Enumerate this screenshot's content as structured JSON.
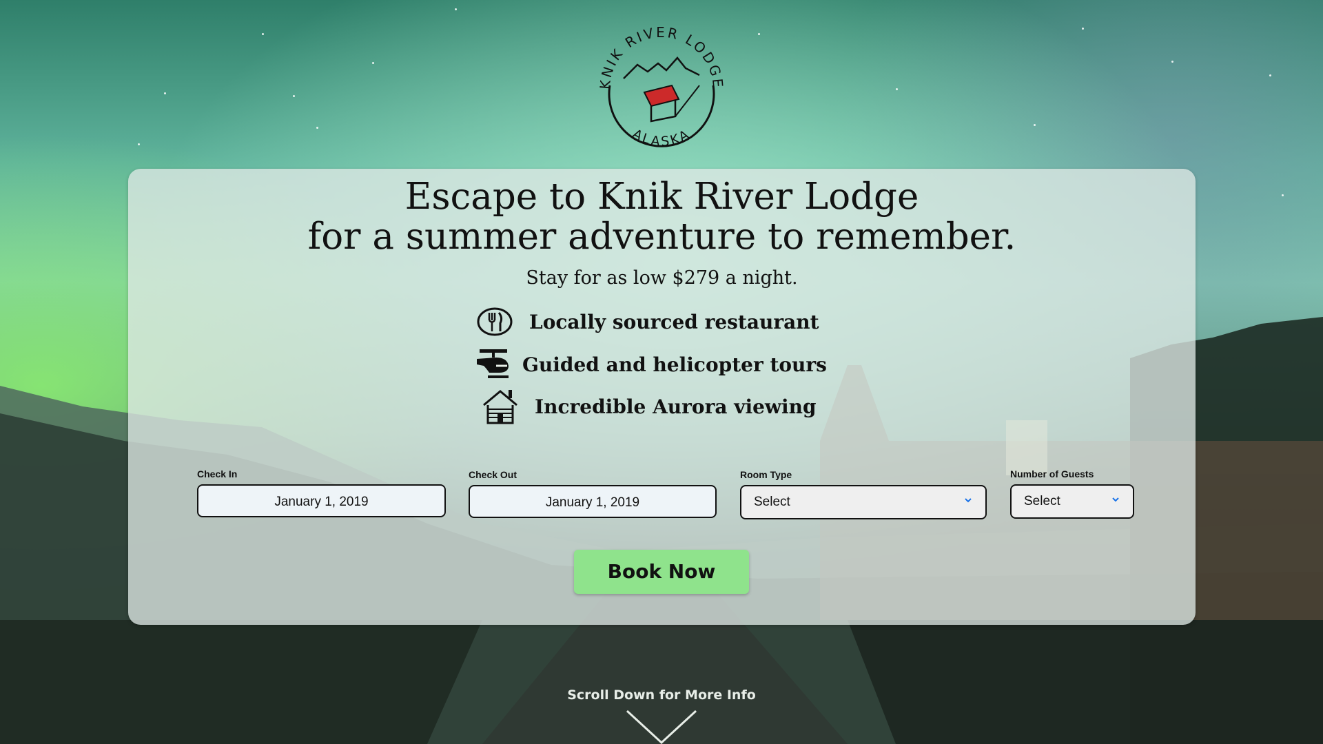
{
  "brand": {
    "logo_name": "KNIK RIVER LODGE",
    "logo_sub": "ALASKA"
  },
  "hero": {
    "headline_line1": "Escape to Knik River Lodge",
    "headline_line2": "for a summer adventure to remember.",
    "price_text": "Stay for as low $279 a night."
  },
  "features": [
    {
      "label": "Locally sourced restaurant",
      "icon": "fork-knife-icon"
    },
    {
      "label": "Guided and helicopter tours",
      "icon": "helicopter-icon"
    },
    {
      "label": "Incredible Aurora viewing",
      "icon": "cabin-icon"
    }
  ],
  "booking": {
    "check_in_label": "Check In",
    "check_in_value": "January 1, 2019",
    "check_out_label": "Check Out",
    "check_out_value": "January 1, 2019",
    "room_type_label": "Room Type",
    "room_type_value": "Select",
    "guests_label": "Number of Guests",
    "guests_value": "Select",
    "book_label": "Book Now"
  },
  "scroll": {
    "hint": "Scroll Down for More Info"
  },
  "colors": {
    "book_button": "#8fe38c",
    "select_chevron": "#1a73e8"
  }
}
